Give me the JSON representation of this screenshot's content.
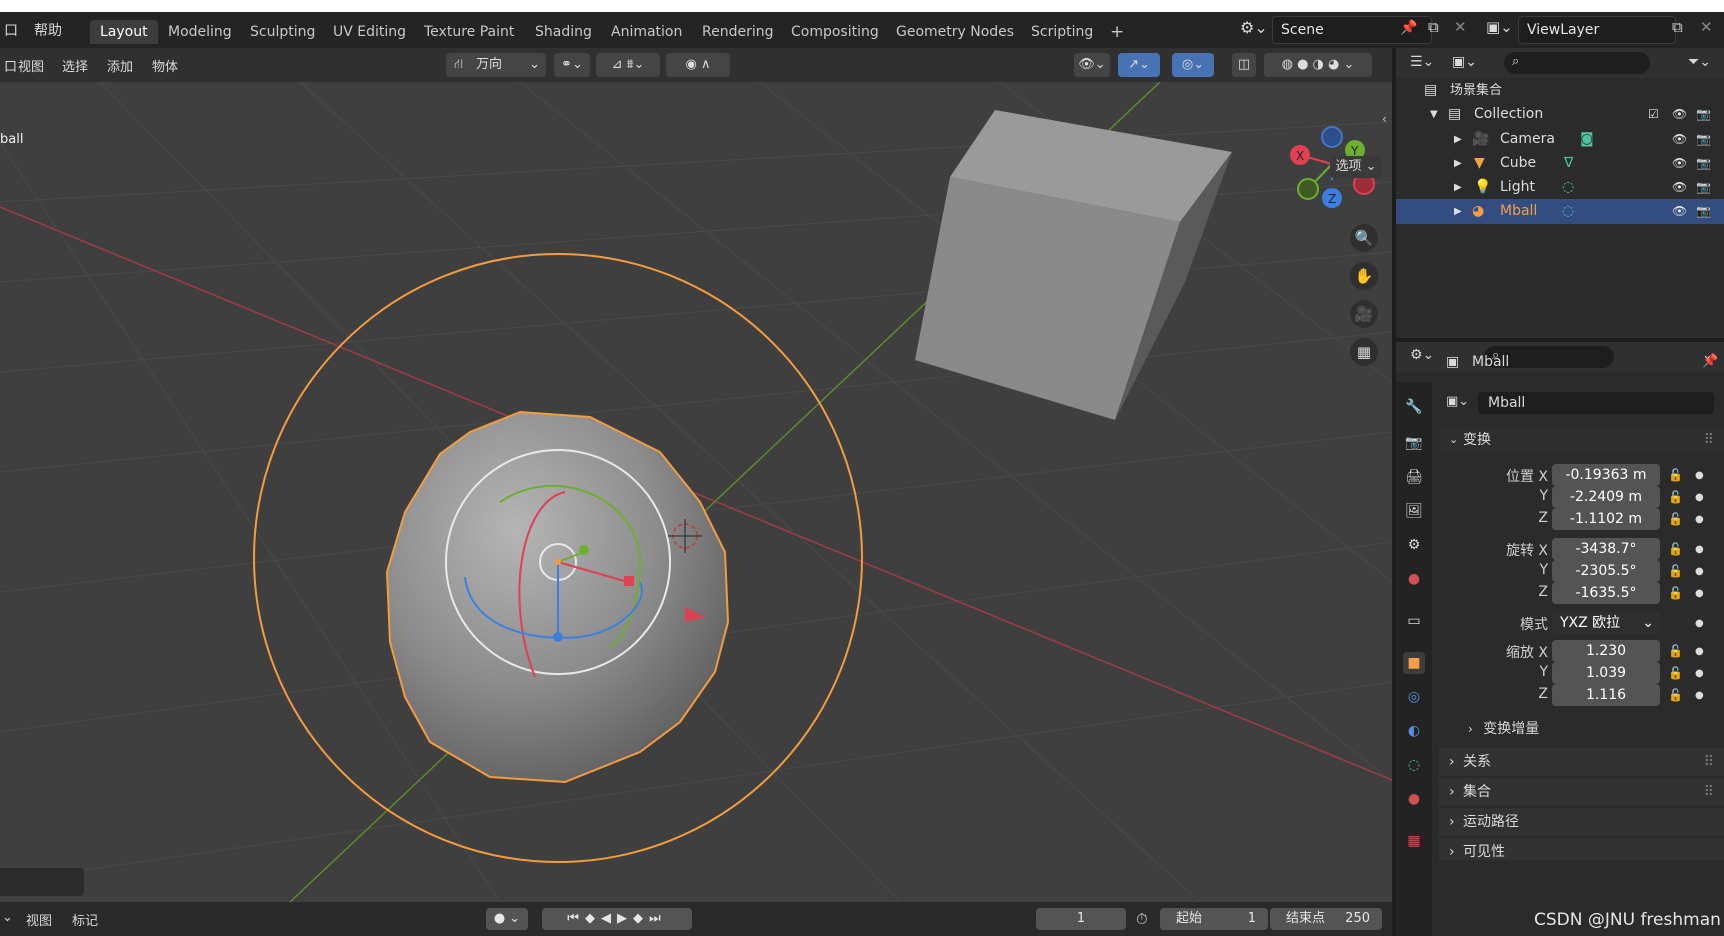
{
  "menu": {
    "help": "帮助"
  },
  "workspace_tabs": [
    "Layout",
    "Modeling",
    "Sculpting",
    "UV Editing",
    "Texture Paint",
    "Shading",
    "Animation",
    "Rendering",
    "Compositing",
    "Geometry Nodes",
    "Scripting",
    "+"
  ],
  "scene": {
    "name": "Scene",
    "view_layer": "ViewLayer"
  },
  "viewport_header": {
    "menus": [
      "视图",
      "选择",
      "添加",
      "物体"
    ],
    "orientation": "万向",
    "options_label": "选项"
  },
  "viewport": {
    "object_label": "ball"
  },
  "outliner": {
    "root": "场景集合",
    "collection": "Collection",
    "items": [
      "Camera",
      "Cube",
      "Light",
      "Mball"
    ],
    "selected": "Mball"
  },
  "properties": {
    "object_name": "Mball",
    "data_name": "Mball",
    "transform_title": "变换",
    "location_label": "位置 X",
    "location": [
      "-0.19363 m",
      "-2.2409 m",
      "-1.1102 m"
    ],
    "rotation_label": "旋转 X",
    "rotation": [
      "-3438.7°",
      "-2305.5°",
      "-1635.5°"
    ],
    "mode_label": "模式",
    "mode_value": "YXZ 欧拉",
    "scale_label": "缩放 X",
    "scale": [
      "1.230",
      "1.039",
      "1.116"
    ],
    "axis_y": "Y",
    "axis_z": "Z",
    "delta_transform": "变换增量",
    "sections": [
      "关系",
      "集合",
      "运动路径",
      "可见性"
    ]
  },
  "timeline": {
    "menus": [
      "视图",
      "标记"
    ],
    "current_frame": "1",
    "start_label": "起始",
    "start": "1",
    "end_label": "结束点",
    "end": "250"
  },
  "watermark": "CSDN @JNU freshman",
  "colors": {
    "accent": "#f5a047",
    "selection": "#334d80",
    "x_axis": "#e0404f",
    "y_axis": "#6cae2f",
    "z_axis": "#3b80e0"
  }
}
